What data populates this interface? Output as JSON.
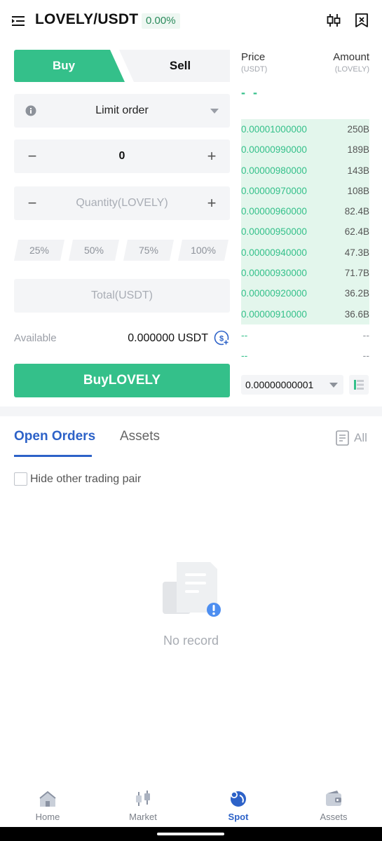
{
  "header": {
    "pair": "LOVELY/USDT",
    "change": "0.00%"
  },
  "side_tabs": {
    "buy": "Buy",
    "sell": "Sell"
  },
  "order_form": {
    "order_type": "Limit order",
    "price_value": "0",
    "minus": "−",
    "plus": "+",
    "quantity_placeholder": "Quantity(LOVELY)",
    "percents": [
      "25%",
      "50%",
      "75%",
      "100%"
    ],
    "total_placeholder": "Total(USDT)",
    "available_label": "Available",
    "available_value": "0.000000 USDT",
    "buy_button": "BuyLOVELY"
  },
  "order_book": {
    "price_header": "Price",
    "price_unit": "(USDT)",
    "amount_header": "Amount",
    "amount_unit": "(LOVELY)",
    "last_price": "- -",
    "bids": [
      {
        "price": "0.00001000000",
        "amount": "250B"
      },
      {
        "price": "0.00000990000",
        "amount": "189B"
      },
      {
        "price": "0.00000980000",
        "amount": "143B"
      },
      {
        "price": "0.00000970000",
        "amount": "108B"
      },
      {
        "price": "0.00000960000",
        "amount": "82.4B"
      },
      {
        "price": "0.00000950000",
        "amount": "62.4B"
      },
      {
        "price": "0.00000940000",
        "amount": "47.3B"
      },
      {
        "price": "0.00000930000",
        "amount": "71.7B"
      },
      {
        "price": "0.00000920000",
        "amount": "36.2B"
      },
      {
        "price": "0.00000910000",
        "amount": "36.6B"
      }
    ],
    "empty_rows": [
      {
        "price": "--",
        "amount": "--"
      },
      {
        "price": "--",
        "amount": "--"
      }
    ],
    "precision": "0.00000000001"
  },
  "orders": {
    "tab_open": "Open Orders",
    "tab_assets": "Assets",
    "filter_all": "All",
    "hide_other": "Hide other trading pair",
    "empty": "No record"
  },
  "nav": {
    "items": [
      {
        "label": "Home"
      },
      {
        "label": "Market"
      },
      {
        "label": "Spot"
      },
      {
        "label": "Assets"
      }
    ]
  },
  "colors": {
    "accent_green": "#34c08a",
    "accent_blue": "#2d62c8"
  }
}
